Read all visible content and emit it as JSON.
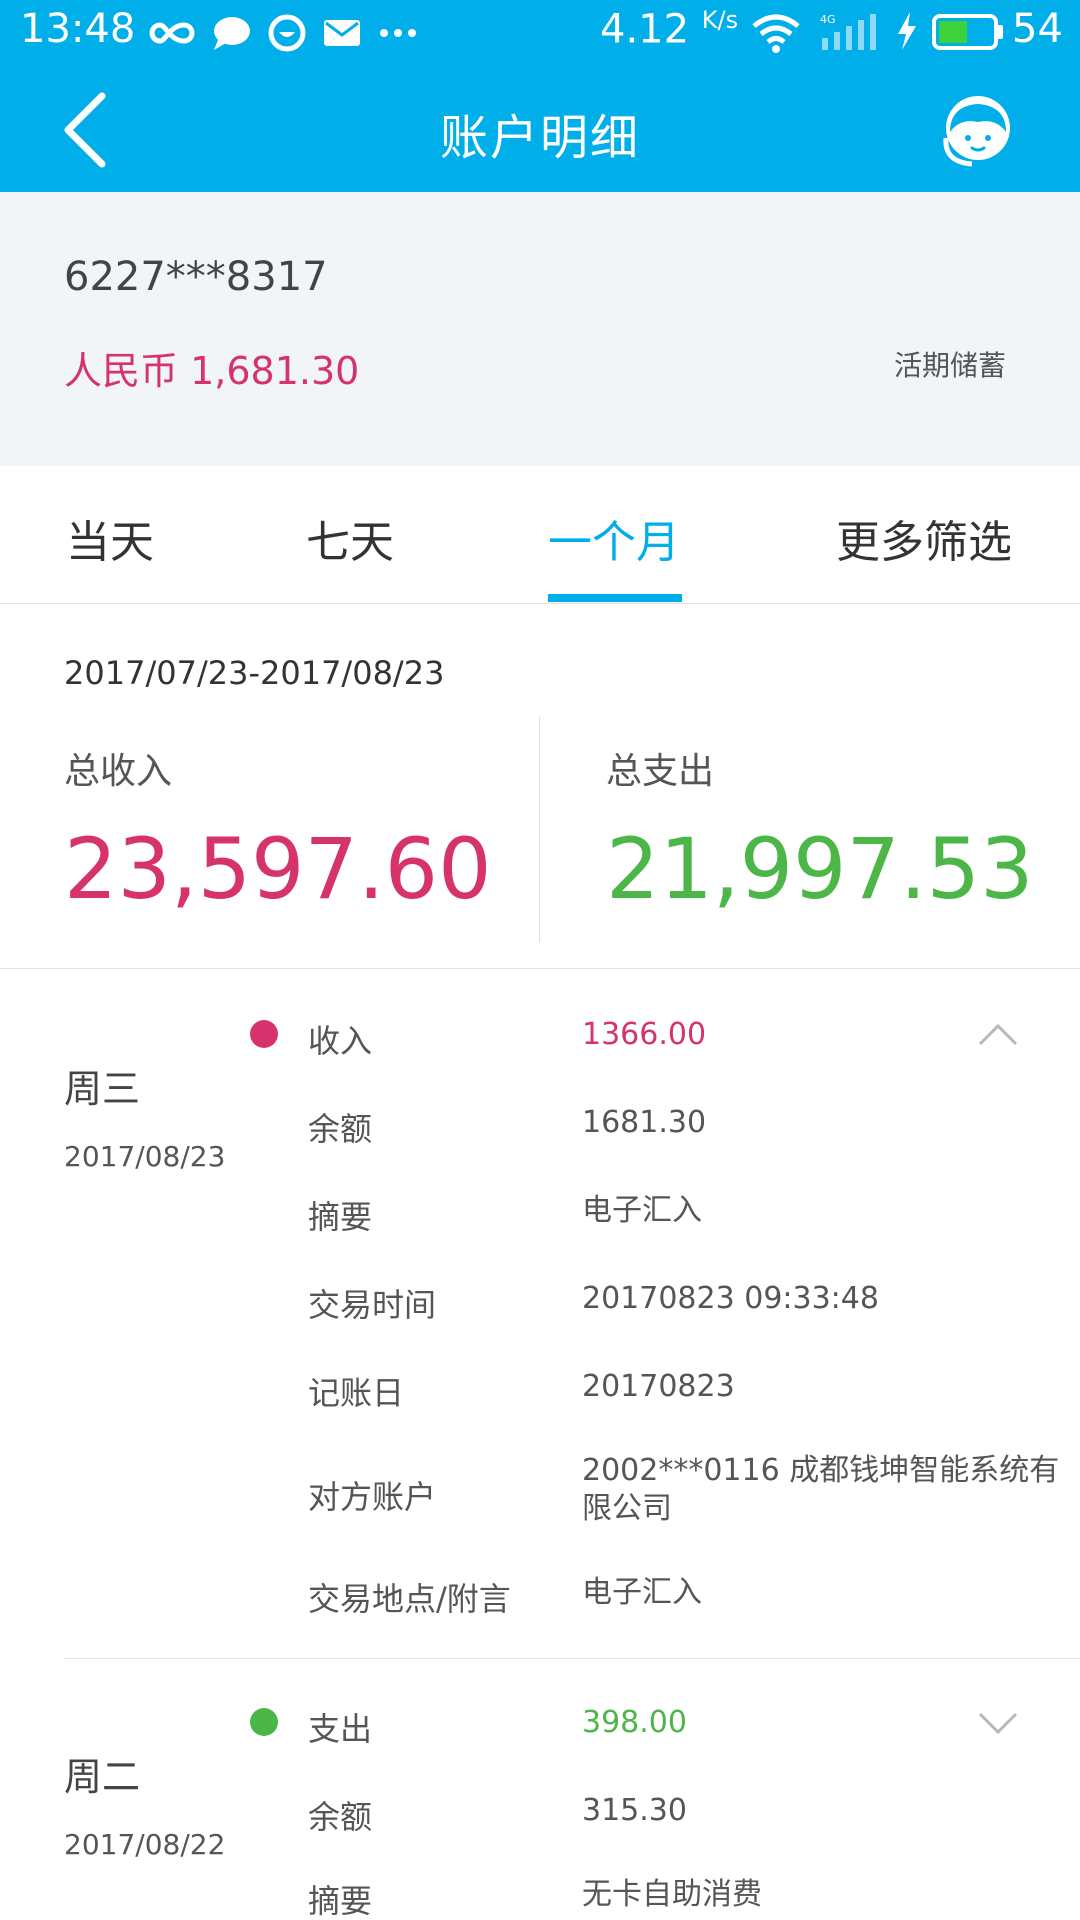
{
  "status_bar": {
    "time": "13:48",
    "network_speed": "4.12",
    "network_speed_unit": "K/s",
    "battery_level": "54",
    "icons": [
      "infinity-icon",
      "chat-bubble-icon",
      "smile-icon",
      "mail-icon",
      "more-dots-icon",
      "wifi-icon",
      "signal-4g-icon",
      "charging-bolt-icon",
      "battery-icon"
    ],
    "battery_fill_fraction": 0.54
  },
  "header": {
    "title": "账户明细",
    "back_icon": "chevron-left-icon",
    "service_icon": "customer-service-icon"
  },
  "account": {
    "number": "6227***8317",
    "balance": "人民币 1,681.30",
    "type": "活期储蓄"
  },
  "tabs": [
    {
      "label": "当天"
    },
    {
      "label": "七天"
    },
    {
      "label": "一个月"
    },
    {
      "label": "更多筛选"
    }
  ],
  "summary": {
    "range": "2017/07/23-2017/08/23",
    "income_label": "总收入",
    "income_value": "23,597.60",
    "expense_label": "总支出",
    "expense_value": "21,997.53"
  },
  "transactions": [
    {
      "weekday": "周三",
      "date": "2017/08/23",
      "kind": "income",
      "expanded": true,
      "rows": [
        {
          "key": "收入",
          "value": "1366.00"
        },
        {
          "key": "余额",
          "value": "1681.30"
        },
        {
          "key": "摘要",
          "value": "电子汇入"
        },
        {
          "key": "交易时间",
          "value": "20170823 09:33:48"
        },
        {
          "key": "记账日",
          "value": "20170823"
        },
        {
          "key": "对方账户",
          "value": "2002***0116 成都钱坤智能系统有限公司"
        },
        {
          "key": "交易地点/附言",
          "value": "电子汇入"
        }
      ]
    },
    {
      "weekday": "周二",
      "date": "2017/08/22",
      "kind": "expense",
      "expanded": false,
      "rows": [
        {
          "key": "支出",
          "value": "398.00"
        },
        {
          "key": "余额",
          "value": "315.30"
        },
        {
          "key": "摘要",
          "value": "无卡自助消费"
        }
      ]
    }
  ],
  "colors": {
    "primary": "#00aee9",
    "income": "#d6336c",
    "expense": "#4cb748"
  }
}
